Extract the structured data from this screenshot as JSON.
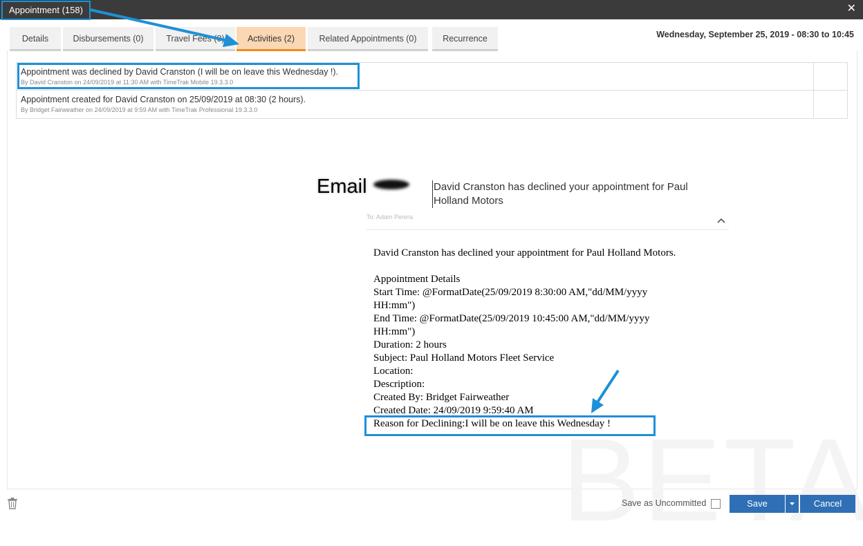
{
  "window": {
    "title": "Appointment (158)",
    "close_glyph": "✕"
  },
  "tabs": [
    {
      "label": "Details"
    },
    {
      "label": "Disbursements (0)"
    },
    {
      "label": "Travel Fees (0)"
    },
    {
      "label": "Activities (2)",
      "active": true
    },
    {
      "label": "Related Appointments (0)"
    },
    {
      "label": "Recurrence"
    }
  ],
  "datetime": "Wednesday, September 25, 2019 - 08:30 to 10:45",
  "activities": [
    {
      "text": "Appointment was declined by David Cranston (I will be on leave this Wednesday !).",
      "meta": "By David Cranston on 24/09/2019 at 11:30 AM with TimeTrak Mobile 19.3.3.0"
    },
    {
      "text": "Appointment created for David Cranston on 25/09/2019 at 08:30 (2 hours).",
      "meta": "By Bridget Fairweather on 24/09/2019 at 9:59 AM with TimeTrak Professional 19.3.3.0"
    }
  ],
  "email": {
    "label": "Email",
    "subject": "David Cranston has declined your appointment for Paul Holland Motors",
    "to": "To:   Adam Perera",
    "body": [
      "David Cranston has declined your appointment for Paul Holland Motors.",
      "",
      "Appointment Details",
      "Start Time: @FormatDate(25/09/2019 8:30:00 AM,\"dd/MM/yyyy HH:mm\")",
      "End Time: @FormatDate(25/09/2019 10:45:00 AM,\"dd/MM/yyyy HH:mm\")",
      "Duration: 2 hours",
      "Subject: Paul Holland Motors Fleet Service",
      "Location:",
      "Description:",
      "Created By: Bridget Fairweather",
      "Created Date: 24/09/2019 9:59:40 AM",
      "Reason for Declining:I will be on leave this Wednesday !"
    ]
  },
  "watermark": "BETA",
  "footer": {
    "save_uncommitted_label": "Save as Uncommitted",
    "save_label": "Save",
    "cancel_label": "Cancel"
  },
  "colors": {
    "highlight": "#1e90d6",
    "active_tab": "#f08a1d",
    "button": "#2f6fb5"
  },
  "icons": [
    "close-icon",
    "trash-icon",
    "chevron-up-icon",
    "caret-down-icon"
  ]
}
